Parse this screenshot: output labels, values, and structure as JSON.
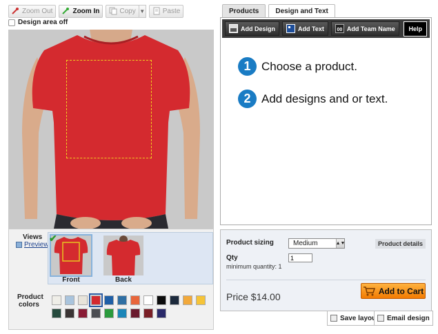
{
  "toolbar": {
    "zoom_out": "Zoom Out",
    "zoom_in": "Zoom In",
    "copy": "Copy",
    "paste": "Paste"
  },
  "design_area": {
    "label": "Design area off",
    "checked": false
  },
  "tabs": [
    {
      "label": "Products",
      "selected": false
    },
    {
      "label": "Design and Text",
      "selected": true
    }
  ],
  "design_bar": {
    "add_design": "Add Design",
    "add_text": "Add Text",
    "add_team_name": "Add Team Name",
    "help": "Help",
    "team_icon_text": "00"
  },
  "steps": [
    {
      "number": "1",
      "text": "Choose a product."
    },
    {
      "number": "2",
      "text": "Add designs and or text."
    }
  ],
  "views": {
    "label": "Views",
    "preview": "Preview",
    "items": [
      {
        "label": "Front",
        "selected": true
      },
      {
        "label": "Back",
        "selected": false
      }
    ]
  },
  "colors": {
    "label": "Product colors",
    "selected": "#d42a2f",
    "swatches": [
      "#efeee8",
      "#a9c4dd",
      "#e8e4da",
      "#d42a2f",
      "#1f5fa6",
      "#2f6fa3",
      "#e8663b",
      "#ffffff",
      "#0c0c0c",
      "#1c2a3c",
      "#f2a93b",
      "#f6c437",
      "#264b3e",
      "#3a3434",
      "#8a1c35",
      "#4b4d52",
      "#2b9a3d",
      "#1b86b8",
      "#6a1a2d",
      "#7a1f26",
      "#2a2a6a"
    ]
  },
  "order": {
    "sizing_label": "Product sizing",
    "size_value": "Medium",
    "details_label": "Product details",
    "qty_label": "Qty",
    "qty_value": "1",
    "min_qty": "minimum quantity: 1",
    "price": "Price $14.00",
    "add_to_cart": "Add to Cart"
  },
  "bottom": {
    "save_layout": "Save layout",
    "email_design": "Email design"
  },
  "product": {
    "shirt_color": "#d42a2f"
  }
}
